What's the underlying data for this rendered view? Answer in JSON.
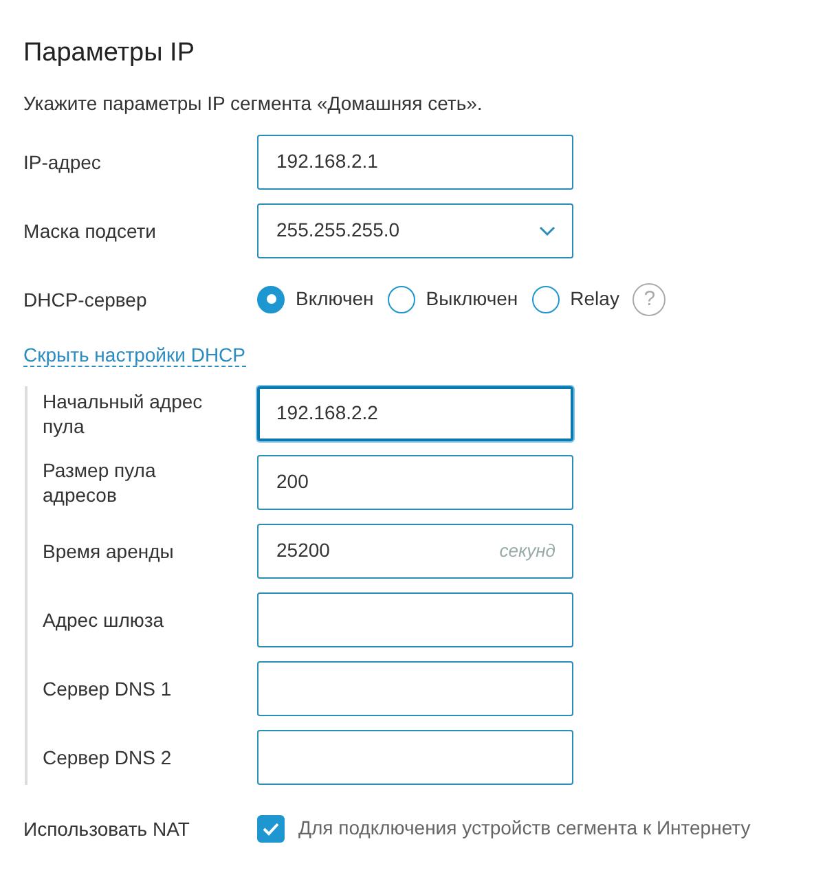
{
  "title": "Параметры IP",
  "description": "Укажите параметры IP сегмента «Домашняя сеть».",
  "fields": [
    {
      "label": "IP-адрес",
      "kind": "text",
      "value": "192.168.2.1"
    },
    {
      "label": "Маска подсети",
      "kind": "select",
      "value": "255.255.255.0"
    }
  ],
  "dhcp": {
    "label": "DHCP-сервер",
    "options": [
      {
        "label": "Включен",
        "selected": true
      },
      {
        "label": "Выключен",
        "selected": false
      },
      {
        "label": "Relay",
        "selected": false
      }
    ],
    "help": "?"
  },
  "toggle_link": "Скрыть настройки DHCP",
  "dhcp_fields": [
    {
      "label": "Начальный адрес пула",
      "value": "192.168.2.2",
      "focused": true
    },
    {
      "label": "Размер пула адресов",
      "value": "200",
      "focused": false
    },
    {
      "label": "Время аренды",
      "value": "25200",
      "suffix": "секунд",
      "focused": false
    },
    {
      "label": "Адрес шлюза",
      "focused": false
    },
    {
      "label": "Сервер DNS 1",
      "focused": false
    },
    {
      "label": "Сервер DNS 2",
      "focused": false
    }
  ],
  "nat": {
    "label": "Использовать NAT",
    "checked": true,
    "text": "Для подключения устройств сегмента к Интернету"
  }
}
